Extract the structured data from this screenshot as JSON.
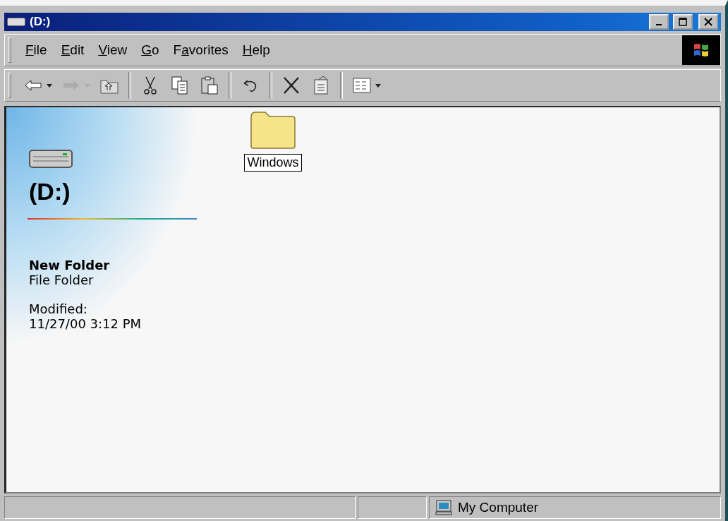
{
  "window": {
    "title": "(D:)"
  },
  "menu": [
    {
      "key": "F",
      "after": "ile"
    },
    {
      "key": "E",
      "after": "dit"
    },
    {
      "key": "V",
      "after": "iew"
    },
    {
      "key": "G",
      "after": "o"
    },
    {
      "before": "F",
      "key": "a",
      "after": "vorites"
    },
    {
      "key": "H",
      "after": "elp"
    }
  ],
  "toolbar": [
    {
      "kind": "back",
      "disabled": false,
      "dropdown": true
    },
    {
      "kind": "forward",
      "disabled": true,
      "dropdown": true
    },
    {
      "kind": "up",
      "disabled": false,
      "dropdown": false
    },
    {
      "kind": "separator"
    },
    {
      "kind": "cut",
      "disabled": false,
      "dropdown": false
    },
    {
      "kind": "copy",
      "disabled": false,
      "dropdown": false
    },
    {
      "kind": "paste",
      "disabled": false,
      "dropdown": false
    },
    {
      "kind": "separator"
    },
    {
      "kind": "undo",
      "disabled": false,
      "dropdown": false
    },
    {
      "kind": "separator"
    },
    {
      "kind": "delete",
      "disabled": false,
      "dropdown": false
    },
    {
      "kind": "properties",
      "disabled": false,
      "dropdown": false
    },
    {
      "kind": "separator"
    },
    {
      "kind": "views",
      "disabled": false,
      "dropdown": true
    }
  ],
  "info_panel": {
    "title": "(D:)",
    "name": "New Folder",
    "type": "File Folder",
    "modified_label": "Modified:",
    "modified": "11/27/00 3:12 PM"
  },
  "items": [
    {
      "label": "Windows",
      "selected": true
    }
  ],
  "status_bar": {
    "zone": "My Computer"
  }
}
